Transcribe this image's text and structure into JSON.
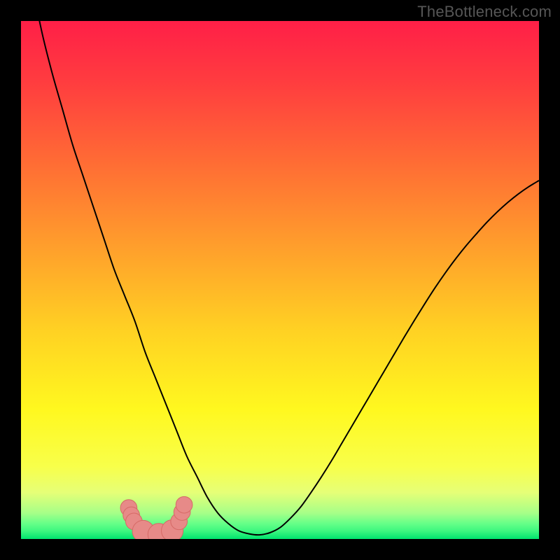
{
  "watermark": "TheBottleneck.com",
  "colors": {
    "frame": "#000000",
    "curve_stroke": "#000000",
    "marker_fill": "#E78A88",
    "marker_stroke": "#D66A66",
    "gradient_stops": [
      {
        "offset": 0.0,
        "color": "#FF1F47"
      },
      {
        "offset": 0.12,
        "color": "#FF3D3F"
      },
      {
        "offset": 0.28,
        "color": "#FF6E34"
      },
      {
        "offset": 0.45,
        "color": "#FFA32B"
      },
      {
        "offset": 0.6,
        "color": "#FFD223"
      },
      {
        "offset": 0.75,
        "color": "#FFF81F"
      },
      {
        "offset": 0.86,
        "color": "#F8FF4A"
      },
      {
        "offset": 0.91,
        "color": "#E6FF77"
      },
      {
        "offset": 0.95,
        "color": "#A6FF88"
      },
      {
        "offset": 0.97,
        "color": "#66FF88"
      },
      {
        "offset": 0.985,
        "color": "#3CF77F"
      },
      {
        "offset": 1.0,
        "color": "#00E46E"
      }
    ]
  },
  "chart_data": {
    "type": "line",
    "title": "",
    "xlabel": "",
    "ylabel": "",
    "xlim": [
      0,
      100
    ],
    "ylim": [
      0,
      100
    ],
    "grid": false,
    "x": [
      0,
      2,
      4,
      6,
      8,
      10,
      12,
      14,
      16,
      18,
      20,
      22,
      24,
      26,
      28,
      30,
      32,
      34,
      36,
      38,
      40,
      42,
      44,
      46,
      48,
      50,
      52,
      54,
      56,
      58,
      60,
      62,
      64,
      66,
      68,
      70,
      72,
      74,
      76,
      78,
      80,
      82,
      84,
      86,
      88,
      90,
      92,
      94,
      96,
      98,
      100
    ],
    "values": [
      120,
      108,
      98,
      90,
      83,
      76,
      70,
      64,
      58,
      52,
      47,
      42,
      36,
      31,
      26,
      21,
      16,
      12,
      8,
      5,
      3,
      1.6,
      1,
      0.8,
      1.2,
      2.2,
      4,
      6.2,
      9,
      12,
      15.2,
      18.6,
      22,
      25.4,
      28.8,
      32.2,
      35.6,
      39,
      42.3,
      45.5,
      48.6,
      51.5,
      54.2,
      56.7,
      59,
      61.2,
      63.2,
      65,
      66.6,
      68,
      69.2
    ],
    "markers": {
      "x": [
        20.8,
        21.3,
        21.8,
        23.6,
        26.6,
        29.2,
        30.5,
        31.1,
        31.5
      ],
      "y": [
        6.0,
        4.6,
        3.4,
        1.5,
        0.9,
        1.6,
        3.4,
        5.2,
        6.6
      ],
      "r": [
        1.6,
        1.6,
        1.6,
        2.1,
        2.1,
        2.1,
        1.6,
        1.6,
        1.6
      ]
    }
  }
}
